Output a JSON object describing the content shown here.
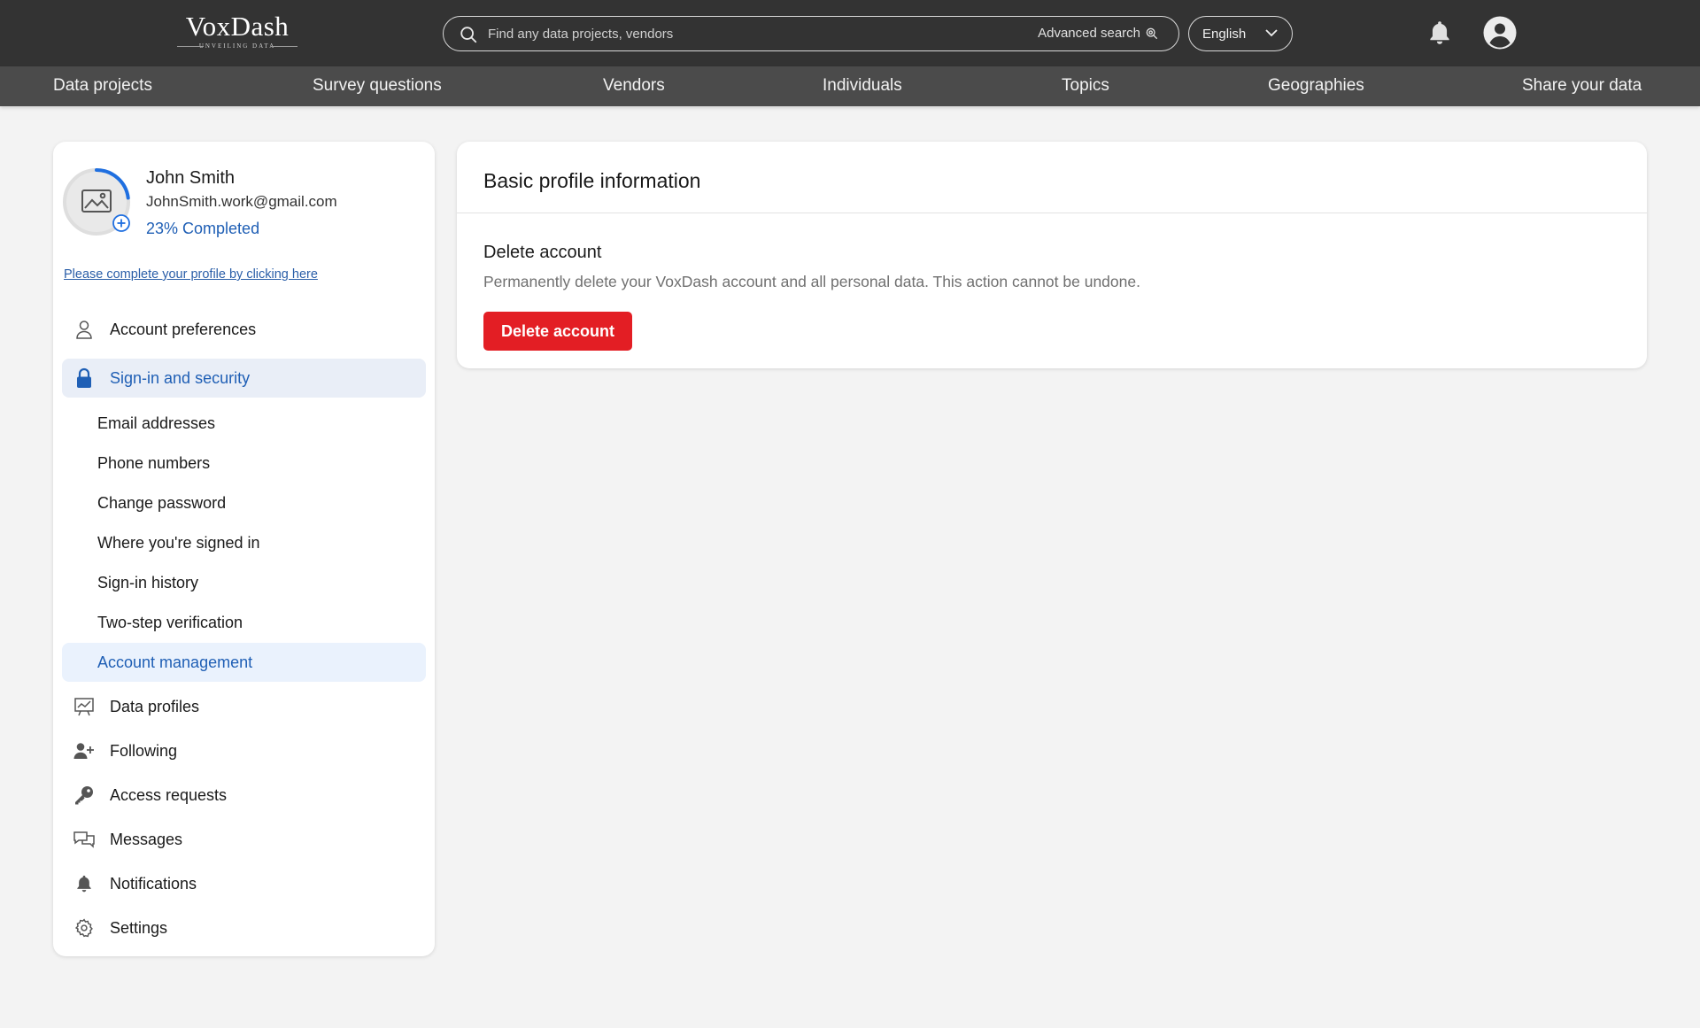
{
  "header": {
    "logo_main": "VoxDash",
    "logo_sub": "UNVEILING DATA",
    "search_placeholder": "Find any data projects, vendors",
    "advanced_search": "Advanced search",
    "language": "English"
  },
  "nav": {
    "items": [
      "Data projects",
      "Survey questions",
      "Vendors",
      "Individuals",
      "Topics",
      "Geographies",
      "Share your data"
    ]
  },
  "profile": {
    "name": "John Smith",
    "email": "JohnSmith.work@gmail.com",
    "progress_text": "23% Completed",
    "progress_fraction": 0.23,
    "complete_link": "Please complete your profile by clicking here"
  },
  "sidebar": {
    "account_preferences": "Account preferences",
    "signin_security": "Sign-in and security",
    "sub_items": [
      "Email addresses",
      "Phone numbers",
      "Change password",
      "Where you're signed in",
      "Sign-in history",
      "Two-step verification",
      "Account management"
    ],
    "data_profiles": "Data profiles",
    "following": "Following",
    "access_requests": "Access requests",
    "messages": "Messages",
    "notifications": "Notifications",
    "settings": "Settings"
  },
  "main": {
    "title": "Basic profile information",
    "delete_title": "Delete account",
    "delete_description": "Permanently delete your VoxDash account and all personal data. This action cannot be undone.",
    "delete_button": "Delete account"
  },
  "colors": {
    "topbar": "#333333",
    "navbar": "#4b4b4b",
    "accent_blue": "#1f5fb5",
    "danger": "#e31e24"
  }
}
